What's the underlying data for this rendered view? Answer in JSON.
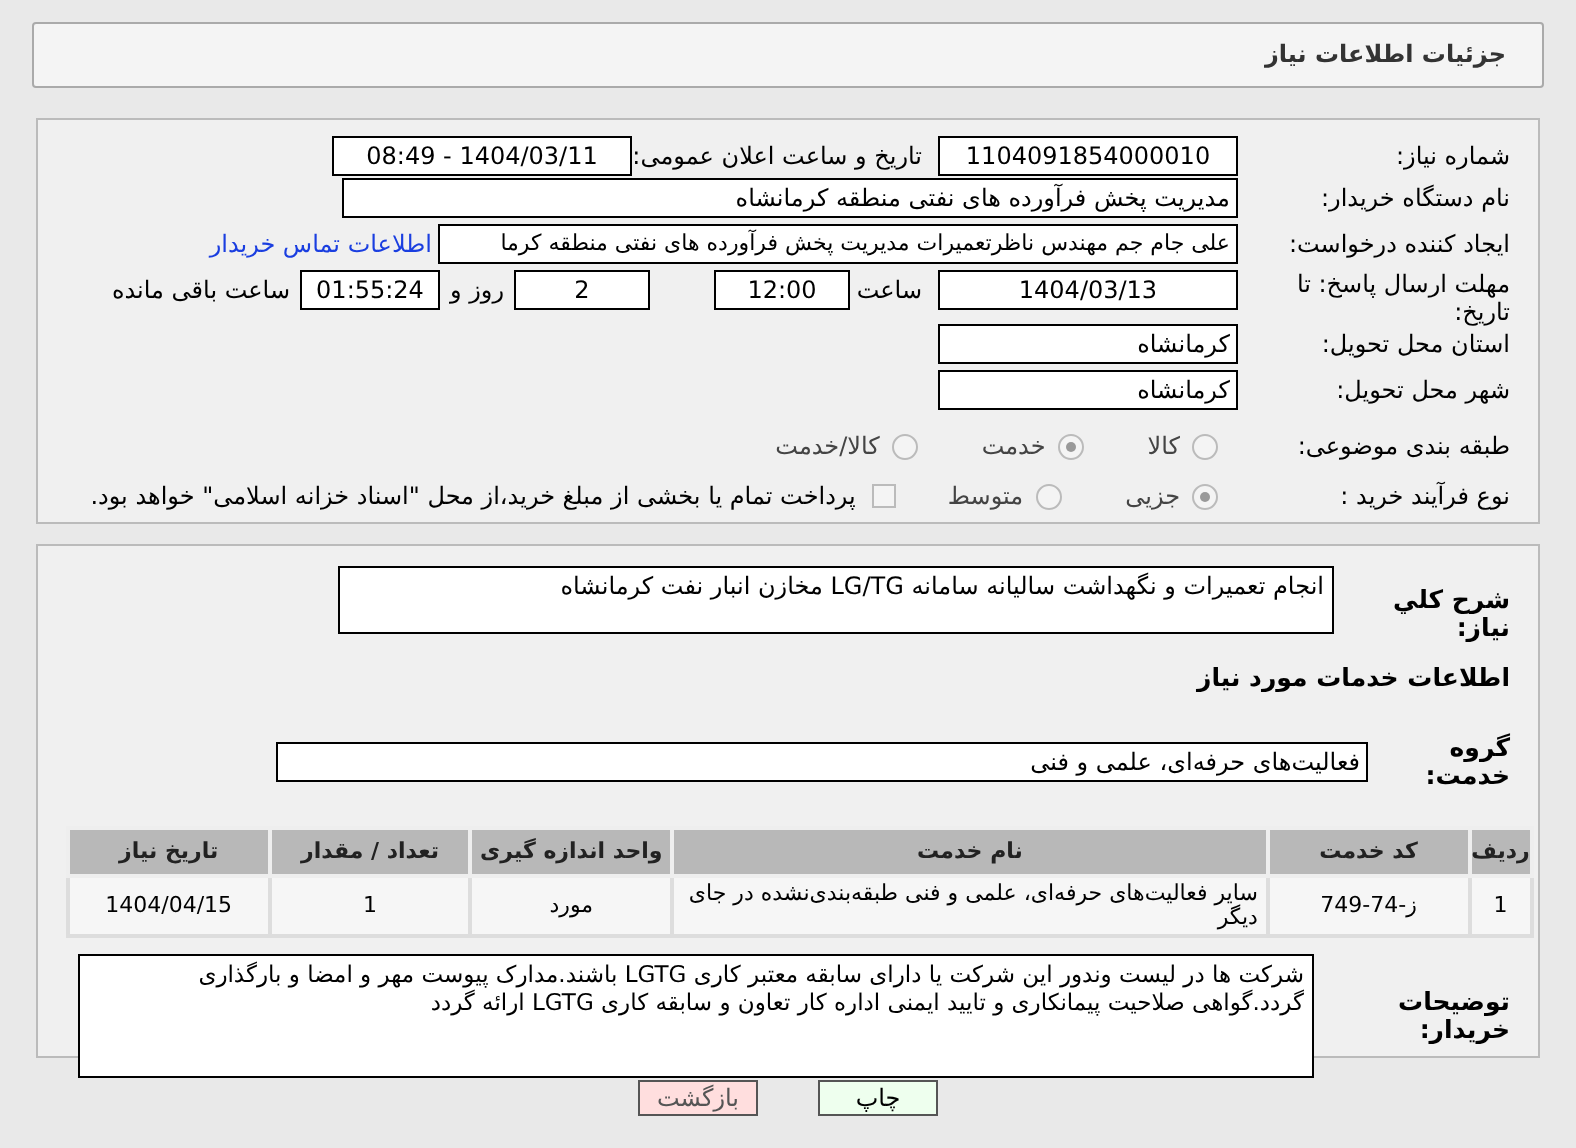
{
  "page_title": "جزئیات اطلاعات نیاز",
  "details": {
    "need_number": {
      "label": "شماره نیاز:",
      "value": "1104091854000010"
    },
    "announce": {
      "label": "تاریخ و ساعت اعلان عمومی:",
      "value": "1404/03/11 - 08:49"
    },
    "buyer_org": {
      "label": "نام دستگاه خریدار:",
      "value": "مدیریت پخش فرآورده های نفتی منطقه کرمانشاه"
    },
    "requester": {
      "label": "ایجاد کننده درخواست:",
      "value": "علی جام جم مهندس ناظرتعمیرات  مدیریت پخش فرآورده های نفتی منطقه کرما",
      "link": "اطلاعات تماس خریدار"
    },
    "deadline": {
      "label": "مهلت ارسال پاسخ: تا تاریخ:",
      "date": "1404/03/13",
      "time_label": "ساعت",
      "time": "12:00",
      "days": "2",
      "days_label": "روز و",
      "remaining": "01:55:24",
      "remaining_label": "ساعت باقی مانده"
    },
    "province": {
      "label": "استان محل تحویل:",
      "value": "کرمانشاه"
    },
    "city": {
      "label": "شهر محل تحویل:",
      "value": "کرمانشاه"
    },
    "category": {
      "label": "طبقه بندی موضوعی:",
      "options": [
        {
          "label": "کالا",
          "selected": false
        },
        {
          "label": "خدمت",
          "selected": true
        },
        {
          "label": "کالا/خدمت",
          "selected": false
        }
      ]
    },
    "process": {
      "label": "نوع فرآیند خرید :",
      "options": [
        {
          "label": "جزیی",
          "selected": true
        },
        {
          "label": "متوسط",
          "selected": false
        }
      ],
      "payment": {
        "label": "پرداخت تمام یا بخشی از مبلغ خرید،از محل \"اسناد خزانه اسلامی\" خواهد بود.",
        "checked": false
      }
    }
  },
  "services": {
    "description": {
      "label": "شرح کلي نياز:",
      "value": "انجام تعمیرات و نگهداشت سالیانه سامانه LG/TG مخازن انبار نفت کرمانشاه"
    },
    "heading": "اطلاعات خدمات مورد نياز",
    "group": {
      "label": "گروه خدمت:",
      "value": "فعالیت‌های حرفه‌ای، علمی و فنی"
    },
    "table": {
      "columns": [
        "ردیف",
        "کد خدمت",
        "نام خدمت",
        "واحد اندازه گیری",
        "تعداد / مقدار",
        "تاریخ نیاز"
      ],
      "rows": [
        [
          "1",
          "ز-74-749",
          "سایر فعالیت‌های حرفه‌ای، علمی و فنی طبقه‌بندی‌نشده در جای دیگر",
          "مورد",
          "1",
          "1404/04/15"
        ]
      ]
    },
    "buyer_notes": {
      "label": "توضیحات خریدار:",
      "value": "شرکت ها در لیست وندور این شرکت یا دارای سابقه معتبر کاری LGTG باشند.مدارک پیوست مهر و امضا و بارگذاری گردد.گواهی صلاحیت پیمانکاری و تایید ایمنی اداره کار تعاون و سابقه کاری LGTG ارائه گردد"
    }
  },
  "buttons": [
    {
      "kind": "print",
      "label": "چاپ"
    },
    {
      "kind": "back",
      "label": "بازگشت"
    }
  ]
}
